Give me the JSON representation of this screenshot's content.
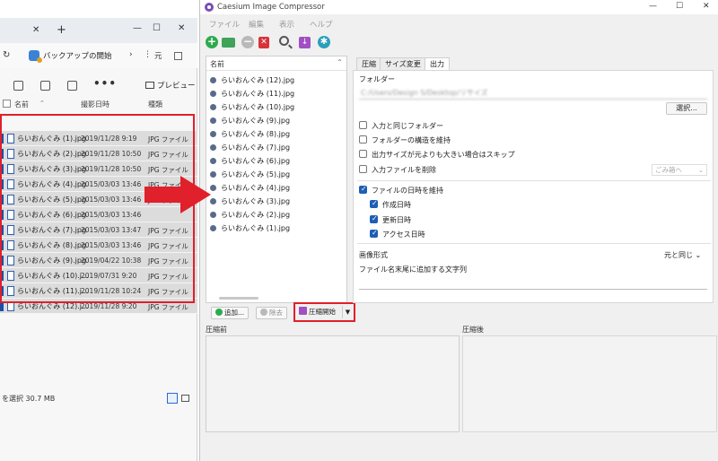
{
  "explorer": {
    "address": "バックアップの開始",
    "back_label": "元",
    "toolbar": {
      "more_label": "•••",
      "preview_label": "プレビュー"
    },
    "columns": {
      "name": "名前",
      "date": "撮影日時",
      "type": "種類"
    },
    "files": [
      {
        "name": "らいおんぐみ (1).jpg",
        "date": "2019/11/28 9:19",
        "type": "JPG ファイル"
      },
      {
        "name": "らいおんぐみ (2).jpg",
        "date": "2019/11/28 10:50",
        "type": "JPG ファイル"
      },
      {
        "name": "らいおんぐみ (3).jpg",
        "date": "2019/11/28 10:50",
        "type": "JPG ファイル"
      },
      {
        "name": "らいおんぐみ (4).jpg",
        "date": "2015/03/03 13:46",
        "type": "JPG ファイル"
      },
      {
        "name": "らいおんぐみ (5).jpg",
        "date": "2015/03/03 13:46",
        "type": "JPG ファイ"
      },
      {
        "name": "らいおんぐみ (6).jpg",
        "date": "2015/03/03 13:46",
        "type": ""
      },
      {
        "name": "らいおんぐみ (7).jpg",
        "date": "2015/03/03 13:47",
        "type": "JPG ファイル"
      },
      {
        "name": "らいおんぐみ (8).jpg",
        "date": "2015/03/03 13:46",
        "type": "JPG ファイル"
      },
      {
        "name": "らいおんぐみ (9).jpg",
        "date": "2019/04/22 10:38",
        "type": "JPG ファイル"
      },
      {
        "name": "らいおんぐみ (10).j...",
        "date": "2019/07/31 9:20",
        "type": "JPG ファイル"
      },
      {
        "name": "らいおんぐみ (11).j...",
        "date": "2019/11/28 10:24",
        "type": "JPG ファイル"
      },
      {
        "name": "らいおんぐみ (12).j...",
        "date": "2019/11/28 9:20",
        "type": "JPG ファイル"
      }
    ],
    "status": "を選択  30.7 MB"
  },
  "caesium": {
    "title": "Caesium Image Compressor",
    "menu": [
      "ファイル",
      "編集",
      "表示",
      "ヘルプ"
    ],
    "list_header": "名前",
    "list_items": [
      "らいおんぐみ (12).jpg",
      "らいおんぐみ (11).jpg",
      "らいおんぐみ (10).jpg",
      "らいおんぐみ (9).jpg",
      "らいおんぐみ (8).jpg",
      "らいおんぐみ (7).jpg",
      "らいおんぐみ (6).jpg",
      "らいおんぐみ (5).jpg",
      "らいおんぐみ (4).jpg",
      "らいおんぐみ (3).jpg",
      "らいおんぐみ (2).jpg",
      "らいおんぐみ (1).jpg"
    ],
    "buttons": {
      "add": "追加...",
      "remove": "除去",
      "compress": "圧縮開始"
    },
    "tabs": [
      "圧縮",
      "サイズ変更",
      "出力"
    ],
    "output": {
      "folder_label": "フォルダー",
      "folder_path": "C:/Users/Design S/Desktop/リサイズ",
      "browse": "選択...",
      "same_folder": "入力と同じフォルダー",
      "keep_structure": "フォルダーの構造を維持",
      "skip_larger": "出力サイズが元よりも大きい場合はスキップ",
      "delete_input": "入力ファイルを削除",
      "delete_mode": "ごみ箱へ",
      "keep_dates": "ファイルの日時を維持",
      "created": "作成日時",
      "modified": "更新日時",
      "accessed": "アクセス日時",
      "format_label": "画像形式",
      "format_value": "元と同じ",
      "suffix_label": "ファイル名末尾に追加する文字列"
    },
    "preview": {
      "before": "圧縮前",
      "after": "圧縮後"
    }
  },
  "colors": {
    "highlight": "#e0202a",
    "accent": "#1e5fb4",
    "compress_icon": "#a24fc4"
  }
}
